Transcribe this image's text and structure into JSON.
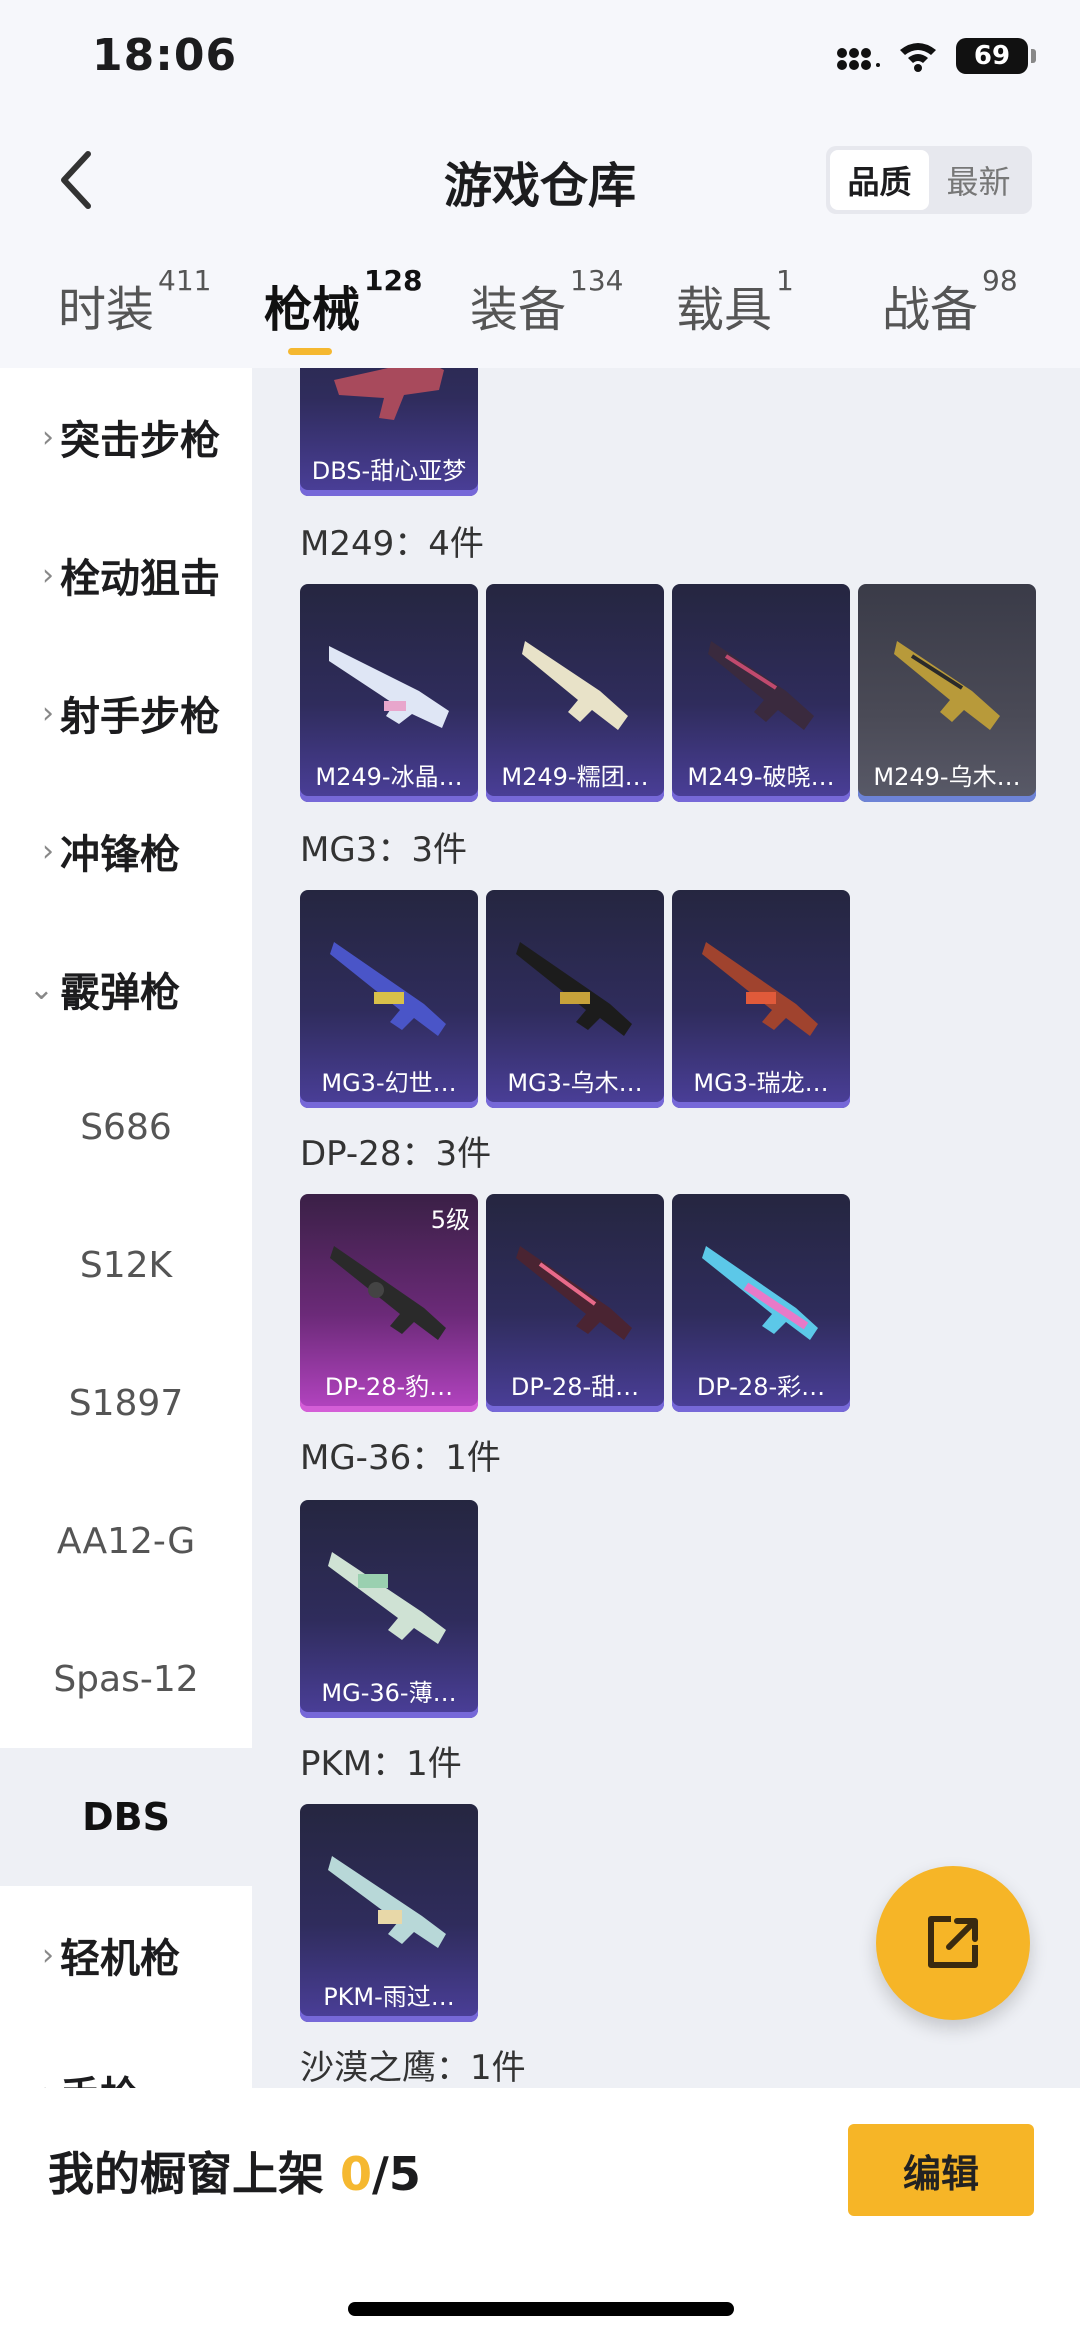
{
  "status_bar": {
    "time": "18:06",
    "battery": "69"
  },
  "header": {
    "title": "游戏仓库",
    "sort_options": [
      "品质",
      "最新"
    ]
  },
  "tabs": [
    {
      "label": "时装",
      "count": "411"
    },
    {
      "label": "枪械",
      "count": "128"
    },
    {
      "label": "装备",
      "count": "134"
    },
    {
      "label": "载具",
      "count": "1"
    },
    {
      "label": "战备",
      "count": "98"
    }
  ],
  "sidebar": {
    "categories": [
      "突击步枪",
      "栓动狙击",
      "射手步枪",
      "冲锋枪",
      "霰弹枪",
      "轻机枪",
      "手枪"
    ],
    "shotgun_items": [
      "S686",
      "S12K",
      "S1897",
      "AA12-G",
      "Spas-12",
      "DBS"
    ]
  },
  "groups": [
    {
      "title": "M249：4件",
      "items": [
        "M249-冰晶…",
        "M249-糯团…",
        "M249-破晓…",
        "M249-乌木…"
      ]
    },
    {
      "title": "MG3：3件",
      "items": [
        "MG3-幻世…",
        "MG3-乌木…",
        "MG3-瑞龙…"
      ]
    },
    {
      "title": "DP-28：3件",
      "items": [
        "DP-28-豹…",
        "DP-28-甜…",
        "DP-28-彩…"
      ],
      "level_badge": "5级"
    },
    {
      "title": "MG-36：1件",
      "items": [
        "MG-36-薄…"
      ]
    },
    {
      "title": "PKM：1件",
      "items": [
        "PKM-雨过…"
      ]
    },
    {
      "title": "沙漠之鹰：1件"
    }
  ],
  "top_partial_item": "DBS-甜心亚梦",
  "bottom_bar": {
    "label": "我的橱窗上架",
    "current": "0",
    "total": "/5",
    "edit_label": "编辑"
  },
  "colors": {
    "accent": "#f6b527",
    "card_blue": "#4b3f9a",
    "card_pink": "#b544c2"
  }
}
